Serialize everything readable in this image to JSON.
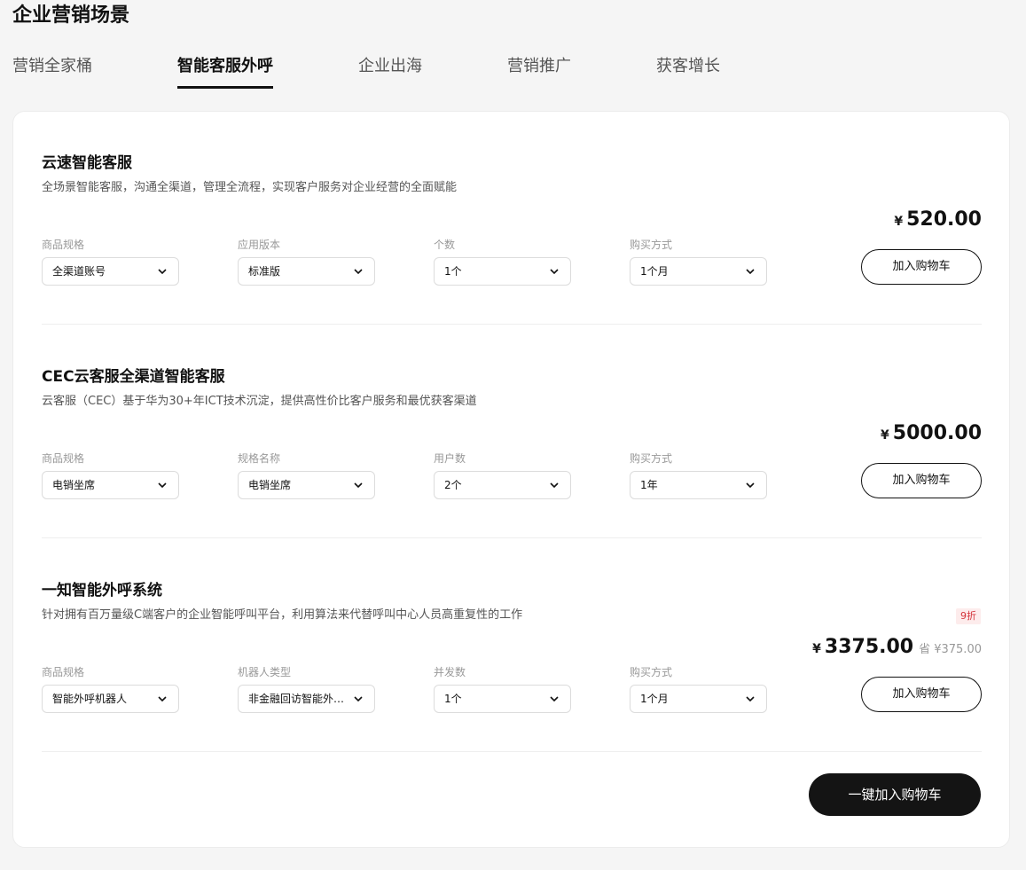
{
  "page_title": "企业营销场景",
  "tabs": [
    {
      "label": "营销全家桶",
      "active": false
    },
    {
      "label": "智能客服外呼",
      "active": true
    },
    {
      "label": "企业出海",
      "active": false
    },
    {
      "label": "营销推广",
      "active": false
    },
    {
      "label": "获客增长",
      "active": false
    }
  ],
  "products": [
    {
      "name": "云速智能客服",
      "description": "全场景智能客服，沟通全渠道，管理全流程，实现客户服务对企业经营的全面赋能",
      "fields": [
        {
          "label": "商品规格",
          "value": "全渠道账号"
        },
        {
          "label": "应用版本",
          "value": "标准版"
        },
        {
          "label": "个数",
          "value": "1个"
        },
        {
          "label": "购买方式",
          "value": "1个月"
        }
      ],
      "currency": "¥",
      "price": "520.00",
      "add_to_cart": "加入购物车"
    },
    {
      "name": "CEC云客服全渠道智能客服",
      "description": "云客服（CEC）基于华为30+年ICT技术沉淀，提供高性价比客户服务和最优获客渠道",
      "fields": [
        {
          "label": "商品规格",
          "value": "电销坐席"
        },
        {
          "label": "规格名称",
          "value": "电销坐席"
        },
        {
          "label": "用户数",
          "value": "2个"
        },
        {
          "label": "购买方式",
          "value": "1年"
        }
      ],
      "currency": "¥",
      "price": "5000.00",
      "add_to_cart": "加入购物车"
    },
    {
      "name": "一知智能外呼系统",
      "description": "针对拥有百万量级C端客户的企业智能呼叫平台，利用算法来代替呼叫中心人员高重复性的工作",
      "fields": [
        {
          "label": "商品规格",
          "value": "智能外呼机器人"
        },
        {
          "label": "机器人类型",
          "value": "非金融回访智能外呼..."
        },
        {
          "label": "并发数",
          "value": "1个"
        },
        {
          "label": "购买方式",
          "value": "1个月"
        }
      ],
      "currency": "¥",
      "price": "3375.00",
      "saving": "省 ¥375.00",
      "discount_badge": "9折",
      "add_to_cart": "加入购物车"
    }
  ],
  "add_all_to_cart": "一键加入购物车",
  "colors": {
    "background": "#f5f5f5",
    "card": "#ffffff",
    "primary_button": "#141414",
    "discount_text": "#d4333a",
    "discount_bg": "#fdecec"
  },
  "icons": {
    "select_arrow": "chevron-down-icon"
  }
}
